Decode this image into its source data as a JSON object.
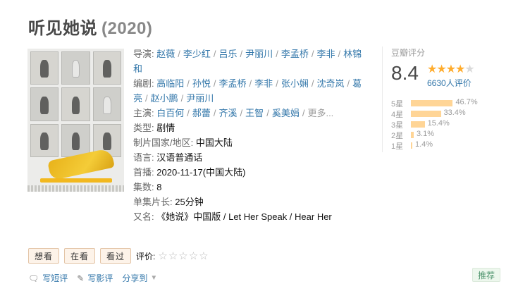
{
  "header": {
    "title": "听见她说",
    "year": "(2020)"
  },
  "info": {
    "director_label": "导演:",
    "directors": [
      "赵薇",
      "李少红",
      "吕乐",
      "尹丽川",
      "李孟桥",
      "李非",
      "林锦和"
    ],
    "writer_label": "编剧:",
    "writers": [
      "高临阳",
      "孙悦",
      "李孟桥",
      "李非",
      "张小娴",
      "沈奇岚",
      "葛亮",
      "赵小鹏",
      "尹丽川"
    ],
    "cast_label": "主演:",
    "cast": [
      "白百何",
      "郝蕾",
      "齐溪",
      "王智",
      "奚美娟"
    ],
    "cast_more": "更多...",
    "genre_label": "类型:",
    "genre": "剧情",
    "country_label": "制片国家/地区:",
    "country": "中国大陆",
    "language_label": "语言:",
    "language": "汉语普通话",
    "premiere_label": "首播:",
    "premiere": "2020-11-17(中国大陆)",
    "episodes_label": "集数:",
    "episodes": "8",
    "runtime_label": "单集片长:",
    "runtime": "25分钟",
    "aka_label": "又名:",
    "aka": "《她说》中国版 / Let Her Speak / Hear Her"
  },
  "rating": {
    "label": "豆瓣评分",
    "score": "8.4",
    "stars_filled": 4,
    "votes": "6630人评价",
    "distribution": [
      {
        "label": "5星",
        "percent": 46.7,
        "text": "46.7%"
      },
      {
        "label": "4星",
        "percent": 33.4,
        "text": "33.4%"
      },
      {
        "label": "3星",
        "percent": 15.4,
        "text": "15.4%"
      },
      {
        "label": "2星",
        "percent": 3.1,
        "text": "3.1%"
      },
      {
        "label": "1星",
        "percent": 1.4,
        "text": "1.4%"
      }
    ]
  },
  "actions": {
    "want": "想看",
    "watching": "在看",
    "watched": "看过",
    "rate_label": "评价:",
    "rate_stars": "☆☆☆☆☆"
  },
  "links": {
    "short_review": "写短评",
    "review": "写影评",
    "share": "分享到"
  },
  "recommend": "推荐",
  "colors": {
    "link": "#3377aa",
    "star": "#ffac2d",
    "bar": "#ffd596",
    "recommend_text": "#4f946e"
  }
}
